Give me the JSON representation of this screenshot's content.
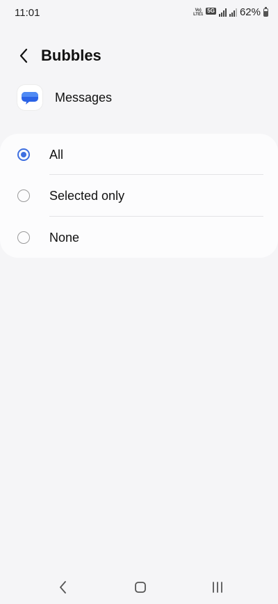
{
  "status_bar": {
    "time": "11:01",
    "volte_line1": "Vo)",
    "volte_line2": "LTE1",
    "network": "5G",
    "battery_percent": "62%",
    "battery_level": 0.62
  },
  "header": {
    "back_icon": "chevron-left-icon",
    "title": "Bubbles"
  },
  "app": {
    "icon": "messages-bubble-icon",
    "name": "Messages",
    "accent": "#2b63e6"
  },
  "options": [
    {
      "label": "All",
      "selected": true
    },
    {
      "label": "Selected only",
      "selected": false
    },
    {
      "label": "None",
      "selected": false
    }
  ],
  "colors": {
    "background": "#f5f5f7",
    "card": "#fcfcfd",
    "radio_selected": "#3e6fe0"
  },
  "navbar": {
    "back": "nav-back-icon",
    "home": "nav-home-icon",
    "recents": "nav-recents-icon"
  }
}
